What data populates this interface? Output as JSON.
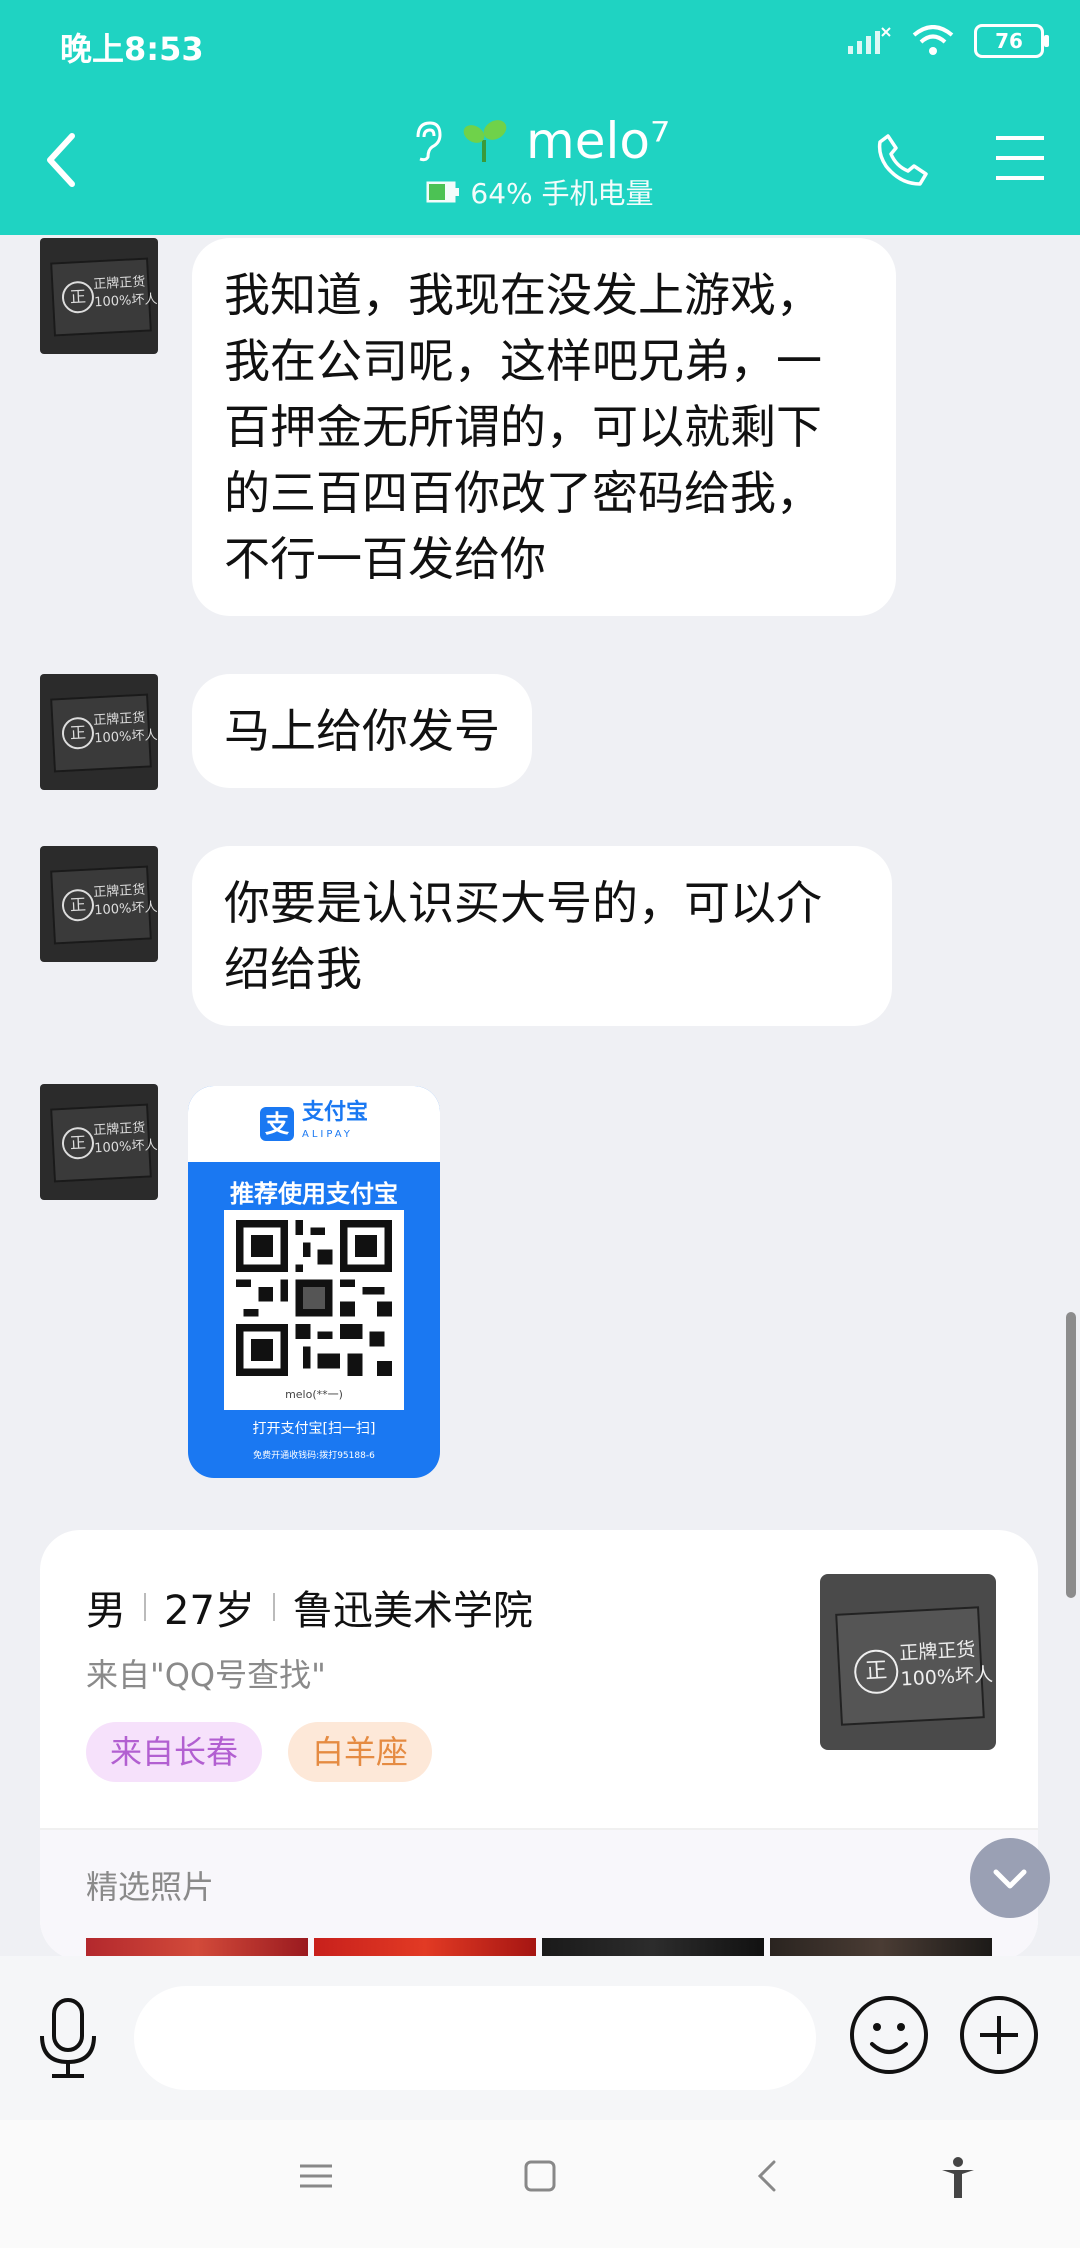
{
  "status_bar": {
    "time": "晚上8:53",
    "battery": "76"
  },
  "header": {
    "title": "melo⁷",
    "subtitle": "64% 手机电量"
  },
  "messages": [
    {
      "text": "我知道，我现在没发上游戏，我在公司呢，这样吧兄弟，一百押金无所谓的，可以就剩下的三百四百你改了密码给我，不行一百发给你"
    },
    {
      "text": "马上给你发号"
    },
    {
      "text": "你要是认识买大号的，可以介绍给我"
    }
  ],
  "avatar_sign": {
    "seal": "正",
    "text": "正牌正货\n100%坏人"
  },
  "qr_card": {
    "brand": "支付宝",
    "brand_en": "ALIPAY",
    "logo_char": "支",
    "headline": "推荐使用支付宝",
    "name": "melo(**一)",
    "scan": "打开支付宝[扫一扫]",
    "footer": "免费开通收钱码:拨打95188-6"
  },
  "profile": {
    "gender": "男",
    "age": "27岁",
    "school": "鲁迅美术学院",
    "source": "来自\"QQ号查找\"",
    "tags": [
      "来自长春",
      "白羊座"
    ],
    "photos_label": "精选照片"
  },
  "input": {
    "placeholder": ""
  },
  "colors": {
    "header": "#1fd3c2",
    "qr_blue": "#1a78f2"
  }
}
